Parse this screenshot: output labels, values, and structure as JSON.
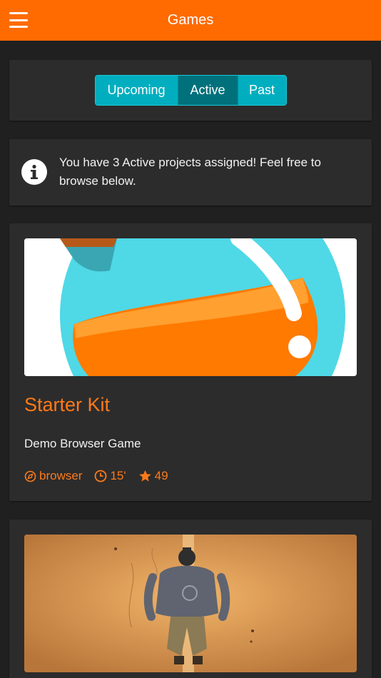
{
  "header": {
    "title": "Games"
  },
  "tabs": [
    {
      "label": "Upcoming"
    },
    {
      "label": "Active"
    },
    {
      "label": "Past"
    }
  ],
  "selected_tab": "Active",
  "info": {
    "text": "You have 3 Active projects assigned! Feel free to browse below."
  },
  "games": [
    {
      "title": "Starter Kit",
      "subtitle": "Demo Browser Game",
      "platform": "browser",
      "duration": "15'",
      "stars": "49"
    },
    {}
  ],
  "colors": {
    "accent": "#ff6b00",
    "tab_active": "#00717b",
    "tab": "#00aebf",
    "background": "#202020",
    "card": "#2c2c2c"
  },
  "icons": {
    "menu": "hamburger-icon",
    "info": "info-icon",
    "platform": "compass-icon",
    "duration": "clock-icon",
    "stars": "star-icon"
  }
}
